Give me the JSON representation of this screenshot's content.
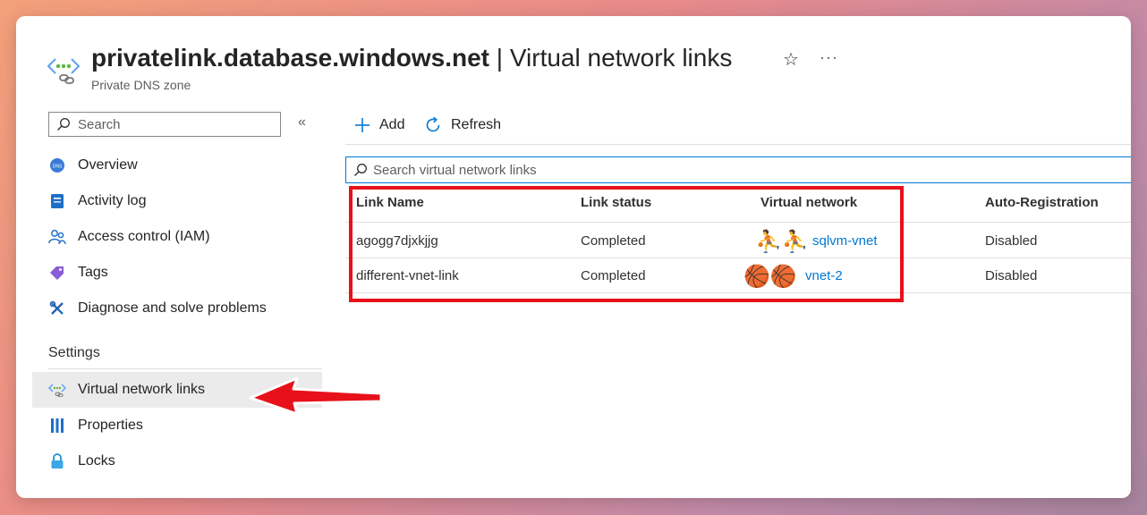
{
  "header": {
    "resource_name": "privatelink.database.windows.net",
    "separator": " | ",
    "page_name": "Virtual network links",
    "subtitle": "Private DNS zone",
    "favorite_icon": "star-icon",
    "more_label": "···"
  },
  "sidebar": {
    "search_placeholder": "Search",
    "collapse_label": "«",
    "items": [
      {
        "label": "Overview",
        "icon": "dns-globe-icon"
      },
      {
        "label": "Activity log",
        "icon": "activity-log-icon"
      },
      {
        "label": "Access control (IAM)",
        "icon": "people-icon"
      },
      {
        "label": "Tags",
        "icon": "tag-icon"
      },
      {
        "label": "Diagnose and solve problems",
        "icon": "wrench-icon"
      }
    ],
    "settings_header": "Settings",
    "settings_items": [
      {
        "label": "Virtual network links",
        "icon": "vnet-link-icon",
        "active": true
      },
      {
        "label": "Properties",
        "icon": "properties-icon"
      },
      {
        "label": "Locks",
        "icon": "lock-icon"
      }
    ]
  },
  "toolbar": {
    "add_label": "Add",
    "refresh_label": "Refresh"
  },
  "list": {
    "search_placeholder": "Search virtual network links",
    "columns": [
      "Link Name",
      "Link status",
      "Virtual network",
      "Auto-Registration"
    ],
    "rows": [
      {
        "link_name": "agogg7djxkjjg",
        "status": "Completed",
        "vnet_emoji": "⛹⛹",
        "vnet_text": "sqlvm-vnet",
        "auto_registration": "Disabled"
      },
      {
        "link_name": "different-vnet-link",
        "status": "Completed",
        "vnet_emoji": "🏀🏀",
        "vnet_text": "vnet-2",
        "auto_registration": "Disabled"
      }
    ]
  },
  "colors": {
    "accent": "#0078d4",
    "highlight": "#e8101a",
    "active_nav": "#ebebeb"
  }
}
